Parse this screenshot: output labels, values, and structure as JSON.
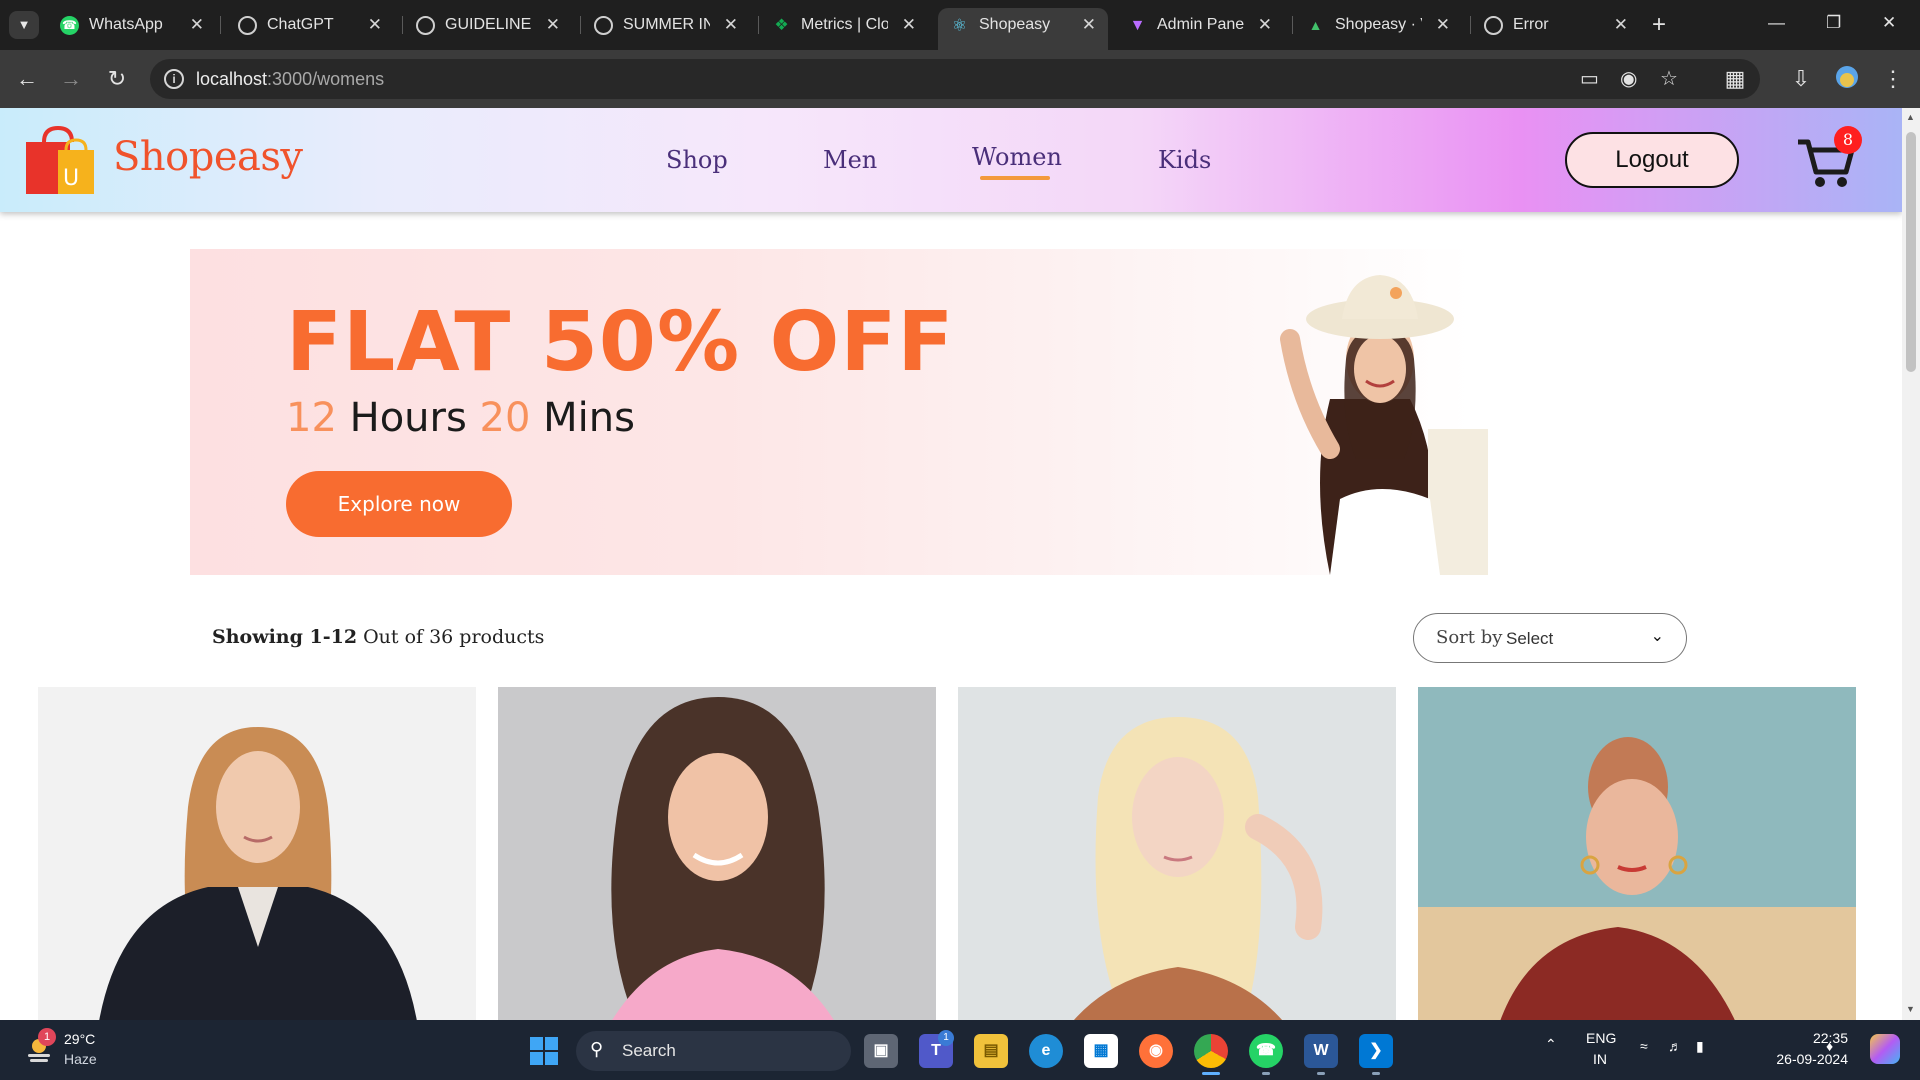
{
  "browser": {
    "tabs": [
      {
        "title": "WhatsApp",
        "icon": "whatsapp-icon",
        "color": "#25d366"
      },
      {
        "title": "ChatGPT",
        "icon": "chatgpt-icon",
        "color": "#9a9a9a"
      },
      {
        "title": "GUIDELINES I",
        "icon": "globe-icon",
        "color": "#9a9a9a"
      },
      {
        "title": "SUMMER INT",
        "icon": "globe-icon",
        "color": "#9a9a9a"
      },
      {
        "title": "Metrics | Clou",
        "icon": "mongodb-leaf-icon",
        "color": "#13aa52"
      },
      {
        "title": "Shopeasy",
        "icon": "react-icon",
        "color": "#61dafb"
      },
      {
        "title": "Admin Panel",
        "icon": "vite-icon",
        "color": "#b96cff"
      },
      {
        "title": "Shopeasy · V",
        "icon": "vercel-icon",
        "color": "#42c16b"
      },
      {
        "title": "Error",
        "icon": "globe-icon",
        "color": "#9a9a9a"
      }
    ],
    "active_tab": 5,
    "url_host": "localhost",
    "url_path": ":3000/womens"
  },
  "site": {
    "brand": "Shopeasy",
    "logo_letter": "U",
    "nav": [
      "Shop",
      "Men",
      "Women",
      "Kids"
    ],
    "active_nav": "Women",
    "logout_label": "Logout",
    "cart_count": "8"
  },
  "hero": {
    "headline": "FLAT 50% OFF",
    "hours": "12",
    "hours_label": "Hours",
    "mins": "20",
    "mins_label": "Mins",
    "cta": "Explore now"
  },
  "listing": {
    "showing_bold": "Showing 1-12",
    "showing_rest": "Out of 36 products",
    "sort_label": "Sort by",
    "sort_value": "Select"
  },
  "products": [
    {
      "name": "woman-fur-jacket",
      "bg": "#f2f2f2"
    },
    {
      "name": "woman-pink-top",
      "bg": "#c9c9cb"
    },
    {
      "name": "woman-blonde-hair",
      "bg": "#dfe3e4"
    },
    {
      "name": "woman-red-top",
      "bg": "#8fb9bd"
    }
  ],
  "taskbar": {
    "weather_temp": "29°C",
    "weather_desc": "Haze",
    "weather_badge": "1",
    "search_label": "Search",
    "teams_badge": "1",
    "lang_top": "ENG",
    "lang_bottom": "IN",
    "time": "22:35",
    "date": "26-09-2024"
  },
  "colors": {
    "brand_orange": "#f0532c",
    "hero_orange": "#f86c30",
    "nav_purple": "#4a2f7a",
    "badge_red": "#ff1f1f"
  }
}
